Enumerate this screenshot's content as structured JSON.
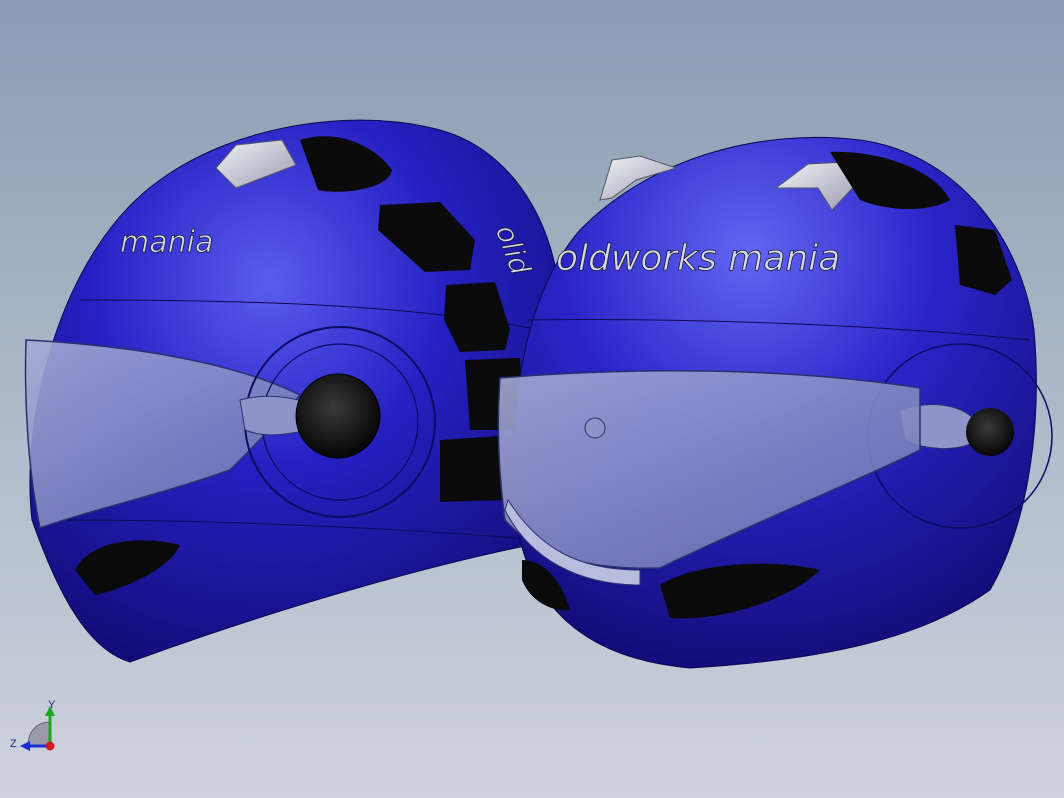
{
  "model": {
    "left_helmet": {
      "logo_text": "mania"
    },
    "right_helmet": {
      "logo_text": "oldworks mania"
    },
    "shell_color": "#1f1aa8",
    "visor_color": "#8e98c4"
  },
  "triad": {
    "y_label": "Y",
    "z_label": "Z",
    "x_color": "#d11a1a",
    "y_color": "#1aa61a",
    "z_color": "#1a2fd6"
  }
}
